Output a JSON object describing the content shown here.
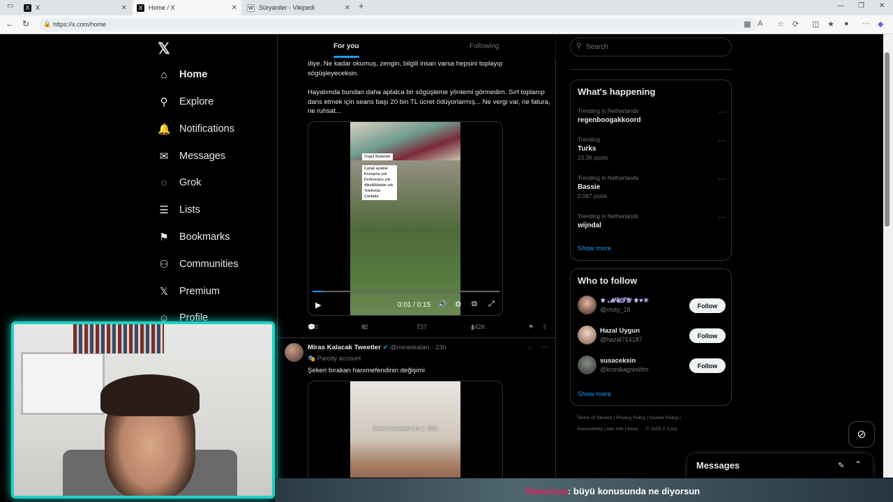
{
  "browser": {
    "tabs": [
      {
        "icon": "X",
        "label": "X"
      },
      {
        "icon": "X",
        "label": "Home / X"
      },
      {
        "icon": "W",
        "label": "Süryaniler - Vikipedi"
      }
    ],
    "url": "https://x.com/home"
  },
  "nav": {
    "items": [
      {
        "label": "Home",
        "icon": "home-icon",
        "glyph": "⌂"
      },
      {
        "label": "Explore",
        "icon": "search-icon",
        "glyph": "⚲"
      },
      {
        "label": "Notifications",
        "icon": "bell-icon",
        "glyph": "🔔"
      },
      {
        "label": "Messages",
        "icon": "envelope-icon",
        "glyph": "✉"
      },
      {
        "label": "Grok",
        "icon": "grok-icon",
        "glyph": "◌"
      },
      {
        "label": "Lists",
        "icon": "list-icon",
        "glyph": "☰"
      },
      {
        "label": "Bookmarks",
        "icon": "bookmark-icon",
        "glyph": "⚑"
      },
      {
        "label": "Communities",
        "icon": "communities-icon",
        "glyph": "⚇"
      },
      {
        "label": "Premium",
        "icon": "x-logo-icon",
        "glyph": "𝕏"
      },
      {
        "label": "Profile",
        "icon": "person-icon",
        "glyph": "☺"
      }
    ]
  },
  "feed": {
    "tabs": [
      "For you",
      "Following"
    ],
    "post1": {
      "text_top": "diye. Ne kadar okumuş, zengin, bilgili insan varsa hepsini toplayıp sögüşleyeceksin.",
      "text_body": "Hayatımda bundan daha aptalca bir sögüşleme yöntemi görmedim. Sırf toplanıp dans etmek için seans başı 20 bin TL ücret ödüyorlarmış... Ne vergi var, ne fatura, ne ruhsat...",
      "video_sign": [
        "Özgür Bedenler",
        "Çıplak ayaklar",
        "Konuşma yok",
        "Performans yok",
        "Alkol&Madde yok",
        "Telefonlar Çantada"
      ],
      "time": "0:01 / 0:15",
      "replies": "133",
      "reposts": "82",
      "likes": "737",
      "views": "142K"
    },
    "post2": {
      "name": "Miras Kalacak Tweetler",
      "handle": "@miraskalan",
      "time": "· 23h",
      "badge": "Parody account",
      "text": "Şekeri bırakan hanımefendinin değişimi",
      "caption": "Şekeri bırakıyorum 1. Gün"
    }
  },
  "search": {
    "placeholder": "Search"
  },
  "happening": {
    "title": "What's happening",
    "trends": [
      {
        "context": "Trending in Netherlands",
        "name": "regenboogakkoord",
        "count": ""
      },
      {
        "context": "Trending",
        "name": "Turks",
        "count": "13.2K posts"
      },
      {
        "context": "Trending in Netherlands",
        "name": "Bassie",
        "count": "2,067 posts"
      },
      {
        "context": "Trending in Netherlands",
        "name": "wijndal",
        "count": ""
      }
    ],
    "show_more": "Show more"
  },
  "who_to_follow": {
    "title": "Who to follow",
    "users": [
      {
        "name": "⚜ 𝓜𝓤𝓣𝓨 ⚜♥☀",
        "handle": "@muty_18"
      },
      {
        "name": "Hazal Uygun",
        "handle": "@hazal714187"
      },
      {
        "name": "susaceksin",
        "handle": "@kronikagresifim"
      }
    ],
    "follow_label": "Follow",
    "show_more": "Show more"
  },
  "footer": {
    "line1": "Terms of Service  |  Privacy Policy  |  Cookie Policy  |",
    "line2": "Accessibility  |  Ads info  |  More ···  © 2025 X Corp."
  },
  "messages": {
    "title": "Messages"
  },
  "chat": {
    "user": "Manaroza",
    "message": ": büyü konusunda ne diyorsun"
  },
  "colors": {
    "accent": "#1d9bf0",
    "cam_border": "#1ed2c4",
    "chat_user": "#e0245e"
  }
}
